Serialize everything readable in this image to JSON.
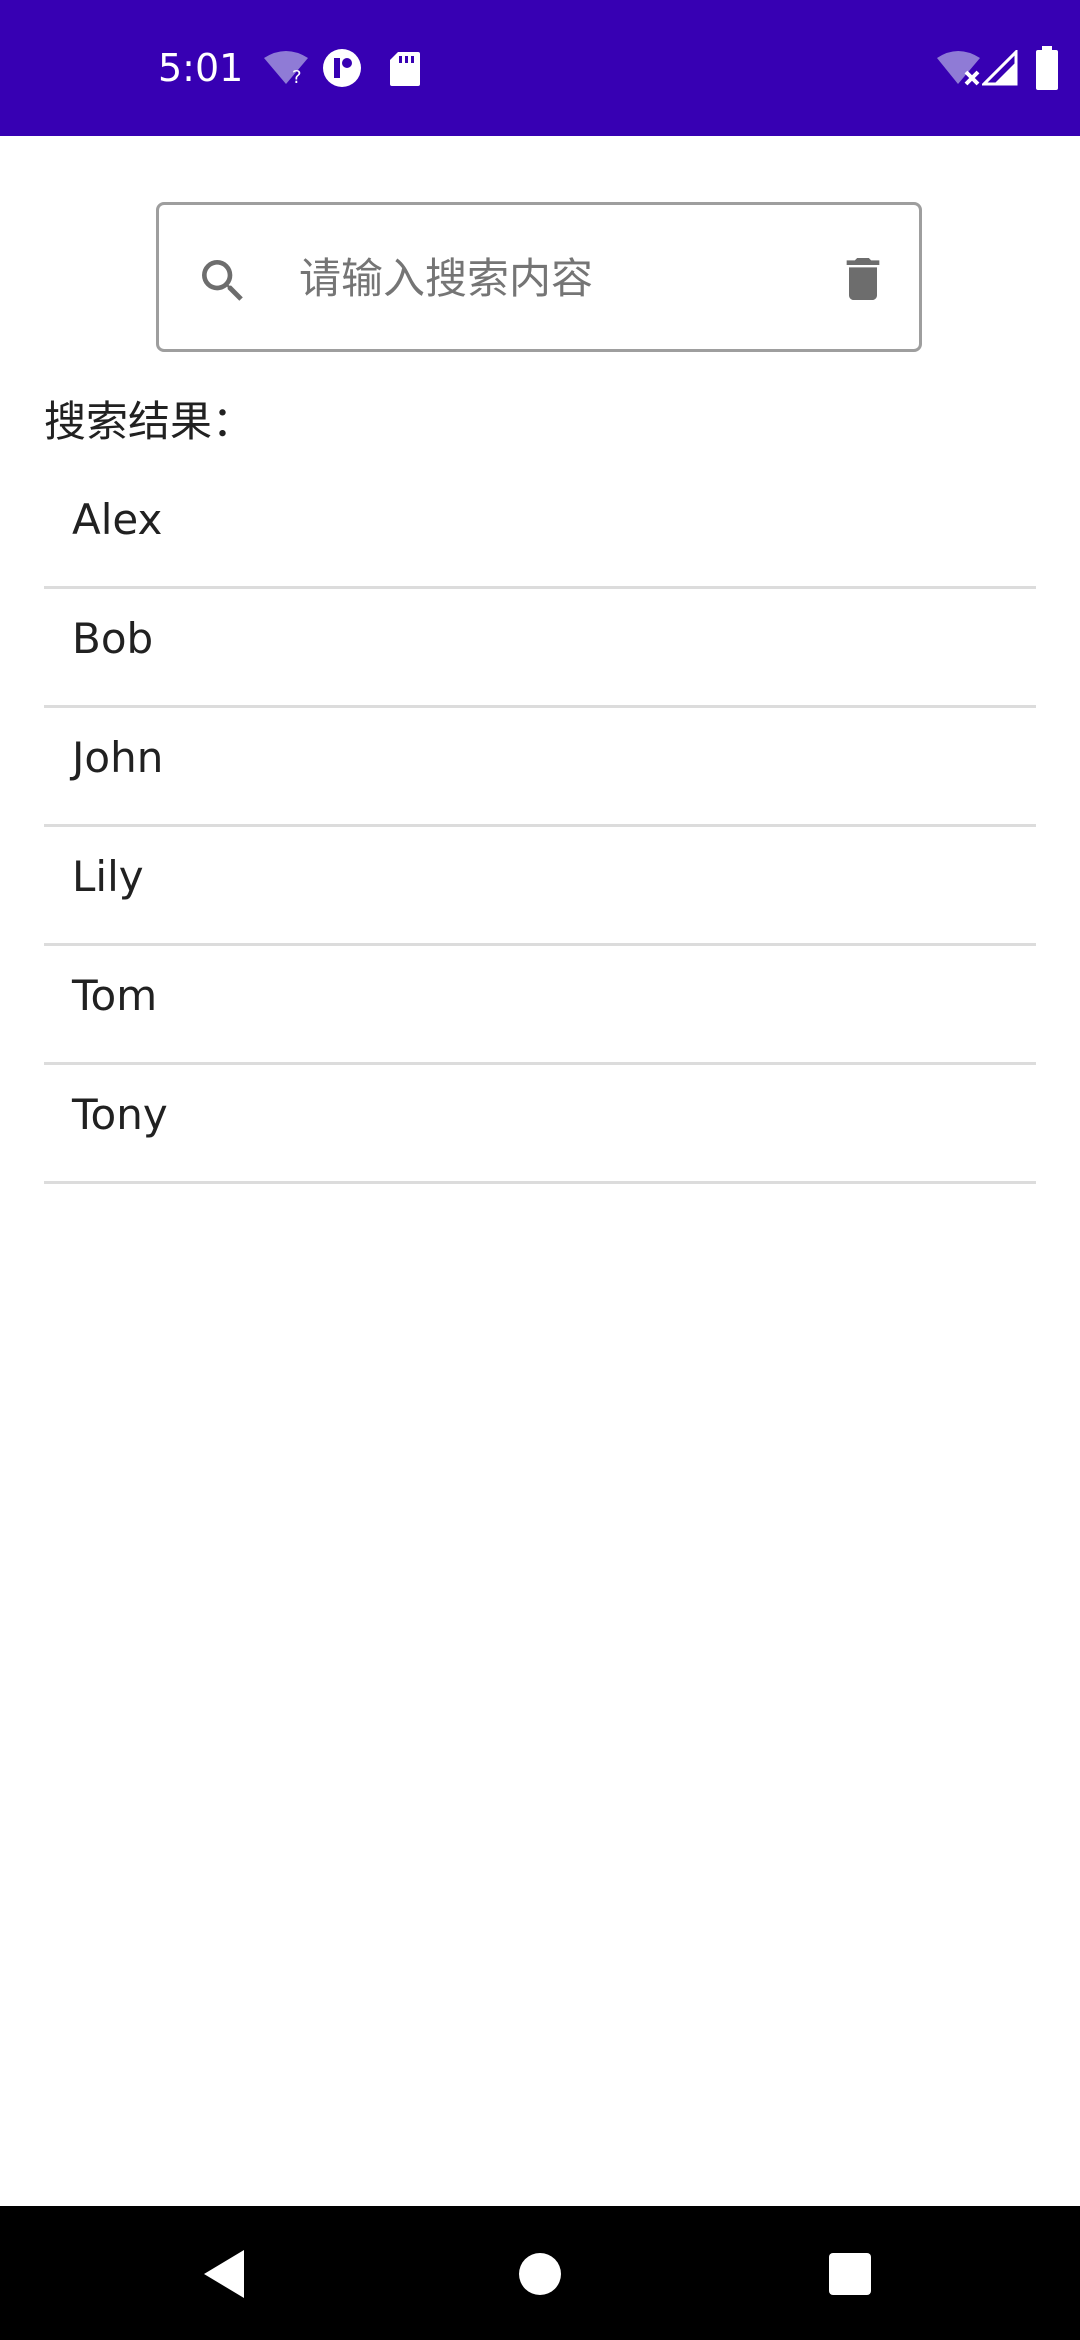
{
  "status_bar": {
    "time": "5:01",
    "background": "#3700b3",
    "icons": [
      "wifi-unknown-icon",
      "app-notification-icon",
      "sd-card-icon",
      "wifi-off-icon",
      "cell-signal-icon",
      "battery-icon"
    ]
  },
  "search": {
    "placeholder": "请输入搜索内容",
    "value": "",
    "search_icon": "search-icon",
    "clear_icon": "trash-icon"
  },
  "results": {
    "label": "搜索结果：",
    "items": [
      "Alex",
      "Bob",
      "John",
      "Lily",
      "Tom",
      "Tony"
    ]
  },
  "nav_bar": {
    "icons": [
      "back-icon",
      "home-icon",
      "recents-icon"
    ]
  }
}
